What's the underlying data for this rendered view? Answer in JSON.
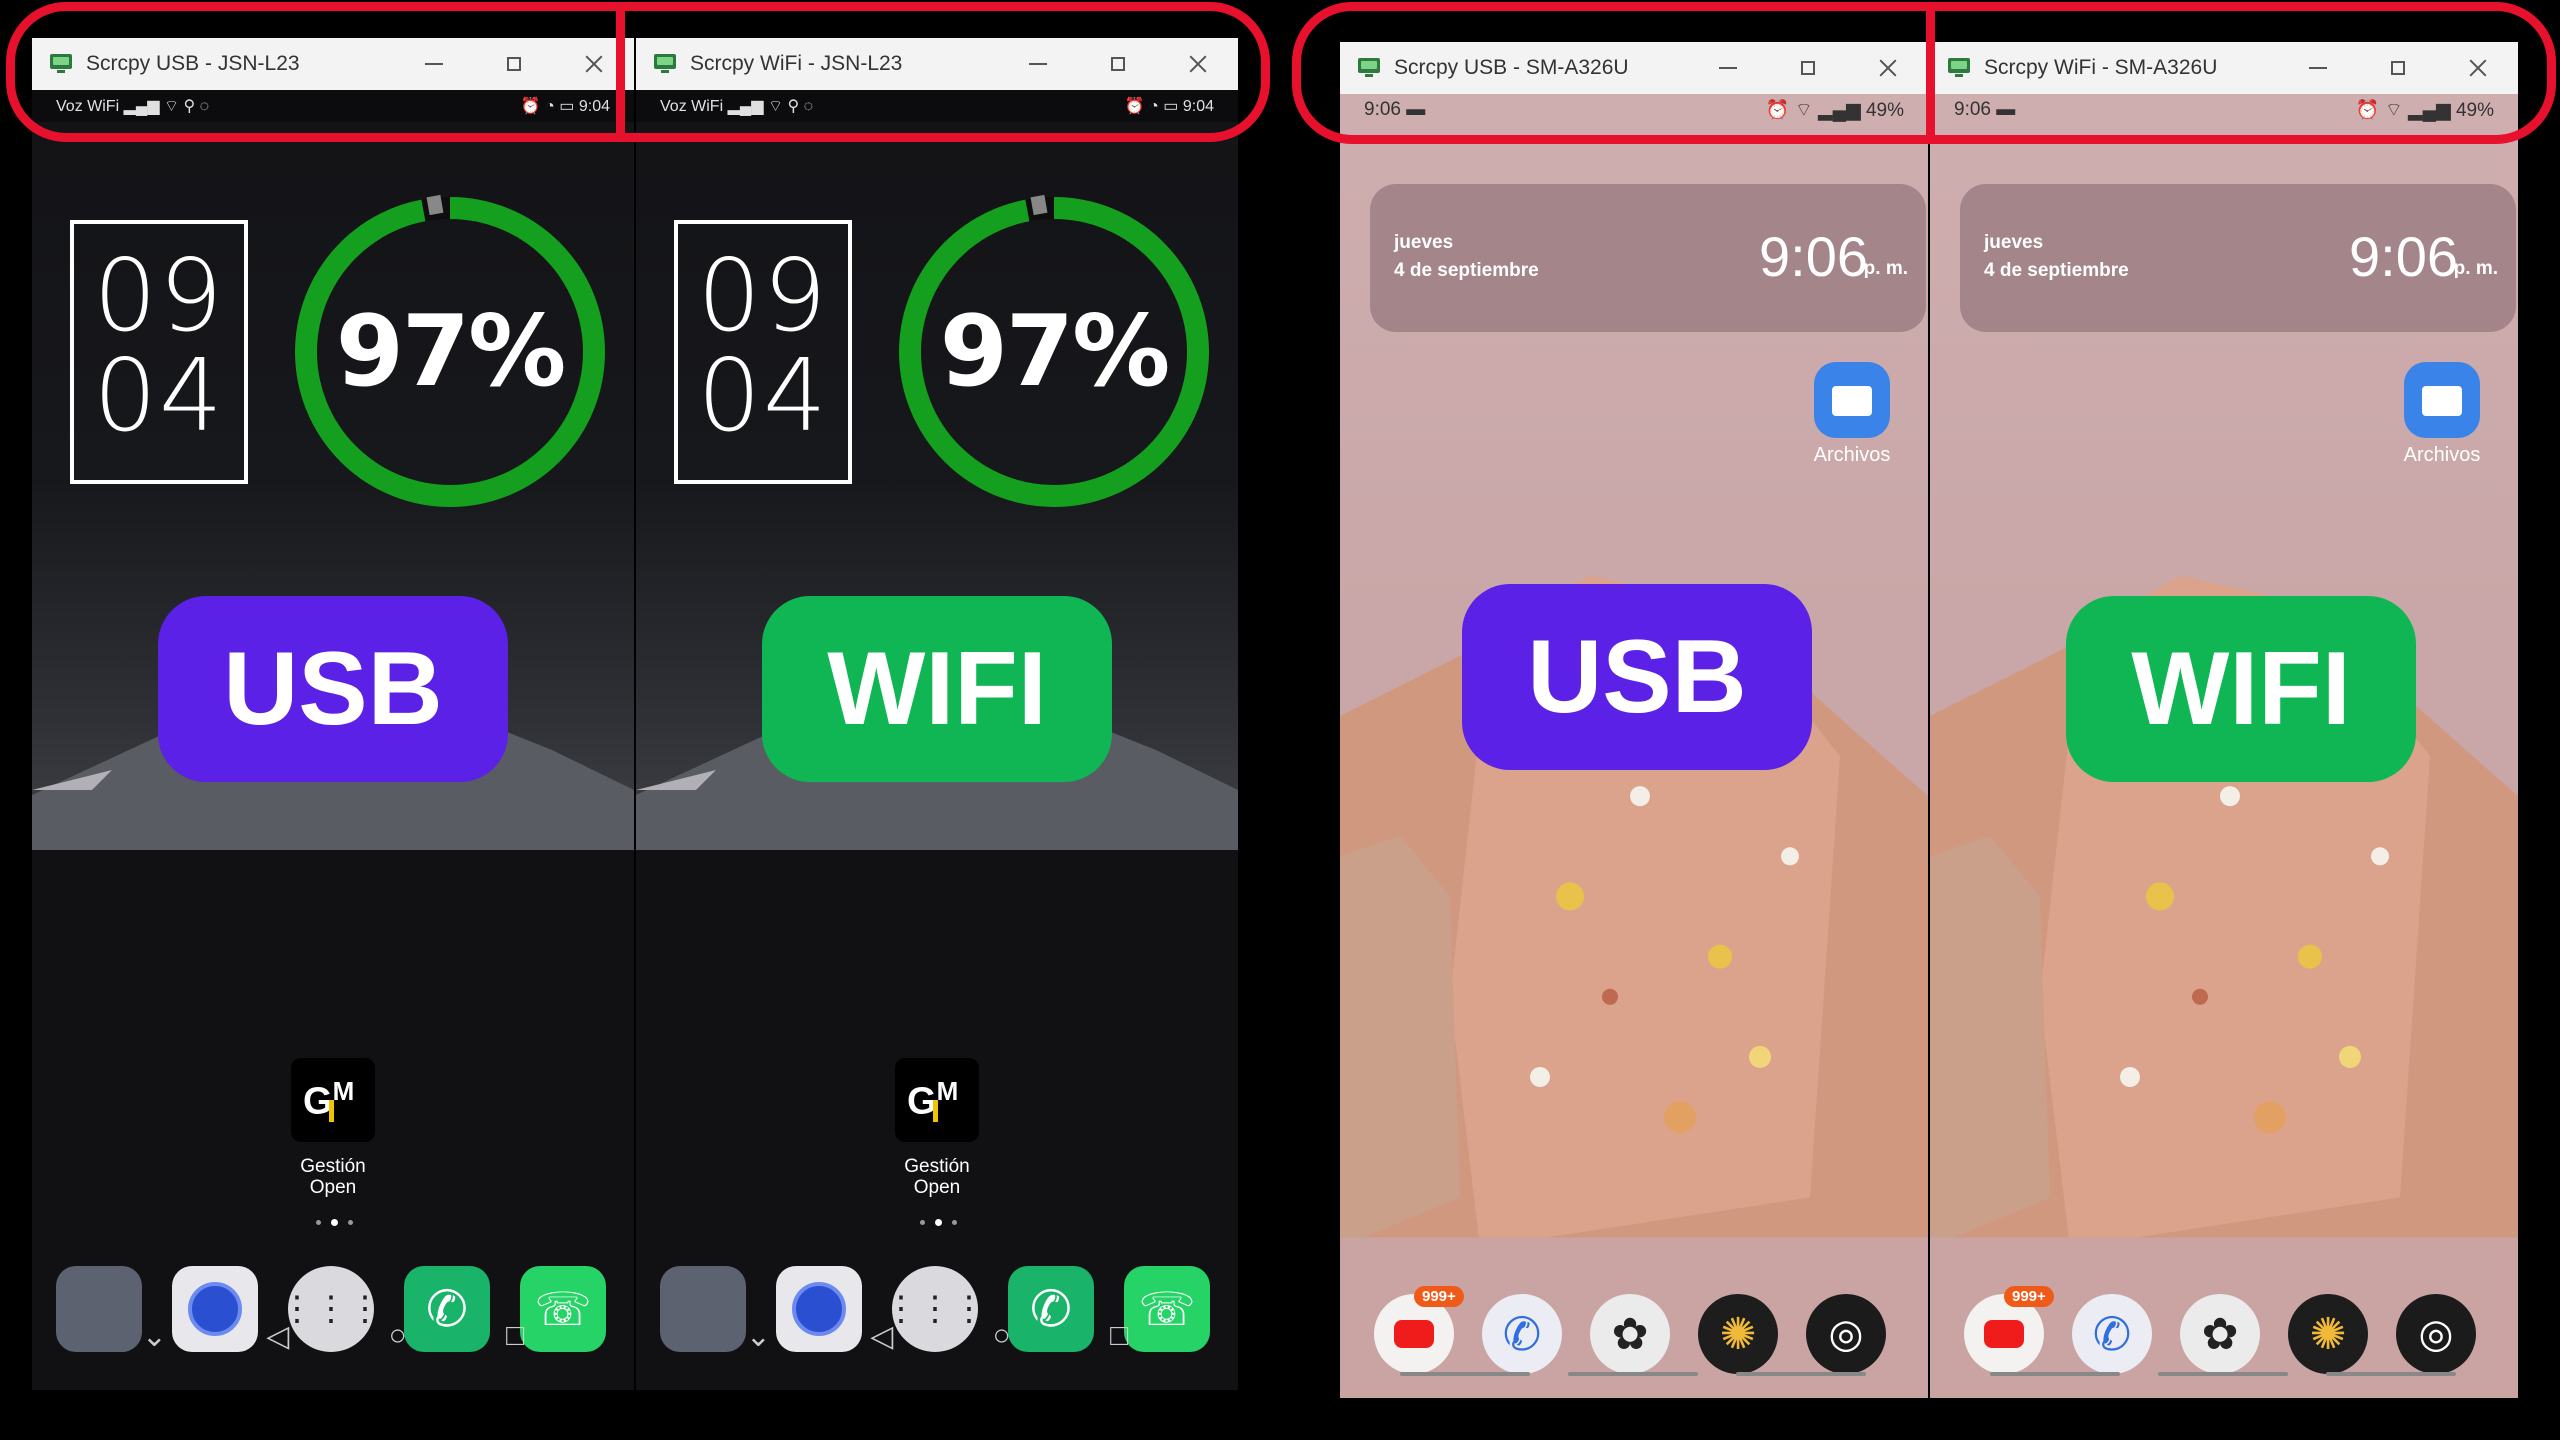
{
  "windows": [
    {
      "title": "Scrcpy USB - JSN-L23",
      "type": "huawei",
      "label": "USB",
      "label_color": "#5b21e6",
      "status": {
        "left": "Voz WiFi",
        "right": "9:04"
      },
      "clock": {
        "hour": "09",
        "minute": "04"
      },
      "battery_pct": "97%",
      "battery_level": 0.97,
      "app": {
        "name": "Gestión Open",
        "line1": "Gestión",
        "line2": "Open",
        "icon": "gm-icon"
      }
    },
    {
      "title": "Scrcpy WiFi - JSN-L23",
      "type": "huawei",
      "label": "WIFI",
      "label_color": "#10b653",
      "status": {
        "left": "Voz WiFi",
        "right": "9:04"
      },
      "clock": {
        "hour": "09",
        "minute": "04"
      },
      "battery_pct": "97%",
      "battery_level": 0.97,
      "app": {
        "name": "Gestión Open",
        "line1": "Gestión",
        "line2": "Open",
        "icon": "gm-icon"
      }
    },
    {
      "title": "Scrcpy USB - SM-A326U",
      "type": "samsung",
      "label": "USB",
      "label_color": "#5b21e6",
      "status": {
        "left": "9:06",
        "right": "49%"
      },
      "widget": {
        "day": "jueves",
        "date": "4 de septiembre",
        "time": "9:06",
        "ampm": "p. m."
      },
      "folder_label": "Archivos",
      "badge": "999+"
    },
    {
      "title": "Scrcpy WiFi - SM-A326U",
      "type": "samsung",
      "label": "WIFI",
      "label_color": "#10b653",
      "status": {
        "left": "9:06",
        "right": "49%"
      },
      "widget": {
        "day": "jueves",
        "date": "4 de septiembre",
        "time": "9:06",
        "ampm": "p. m."
      },
      "folder_label": "Archivos",
      "badge": "999+"
    }
  ],
  "colors": {
    "highlight": "#e8112d",
    "ring": "#14a01e",
    "usb": "#5b21e6",
    "wifi": "#10b653"
  },
  "huawei_dock": [
    "apps-folder-icon",
    "camera-icon",
    "app-drawer-icon",
    "phone-icon",
    "whatsapp-icon"
  ],
  "samsung_dock": [
    "youtube-icon",
    "phone-icon",
    "chatgpt-icon",
    "gallery-icon",
    "camera-icon"
  ]
}
